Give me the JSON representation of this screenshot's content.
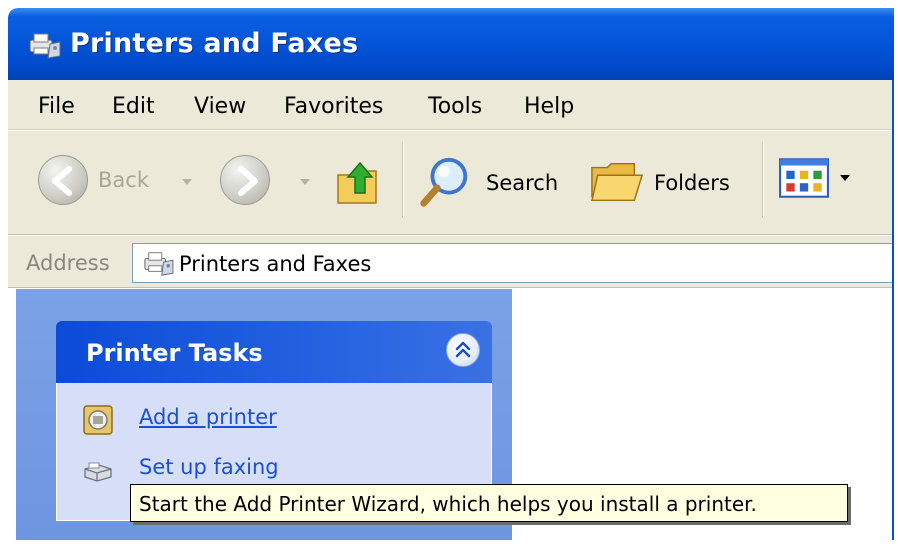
{
  "window": {
    "title": "Printers and Faxes",
    "title_icon": "printers-faxes-icon",
    "titlebar_color": "#0354d8"
  },
  "menu": {
    "items": [
      {
        "label": "File"
      },
      {
        "label": "Edit"
      },
      {
        "label": "View"
      },
      {
        "label": "Favorites"
      },
      {
        "label": "Tools"
      },
      {
        "label": "Help"
      }
    ]
  },
  "toolbar": {
    "back_label": "Back",
    "back_icon": "back-arrow-icon",
    "forward_icon": "forward-arrow-icon",
    "up_icon": "up-folder-icon",
    "search_label": "Search",
    "search_icon": "magnifier-icon",
    "folders_label": "Folders",
    "folders_icon": "folder-icon",
    "views_icon": "views-icon"
  },
  "address": {
    "label": "Address",
    "value": "Printers and Faxes",
    "icon": "printers-faxes-icon"
  },
  "tasks": {
    "title": "Printer Tasks",
    "collapse_icon": "double-chevron-up-icon",
    "items": [
      {
        "label": "Add a printer",
        "icon": "add-printer-icon"
      },
      {
        "label": "Set up faxing",
        "icon": "fax-icon"
      }
    ],
    "pane_color": "#7ba2e7",
    "header_color": "#0c4bd8",
    "link_color": "#1a4fd6"
  },
  "tooltip": {
    "text": "Start the Add Printer Wizard, which helps you install a printer."
  }
}
